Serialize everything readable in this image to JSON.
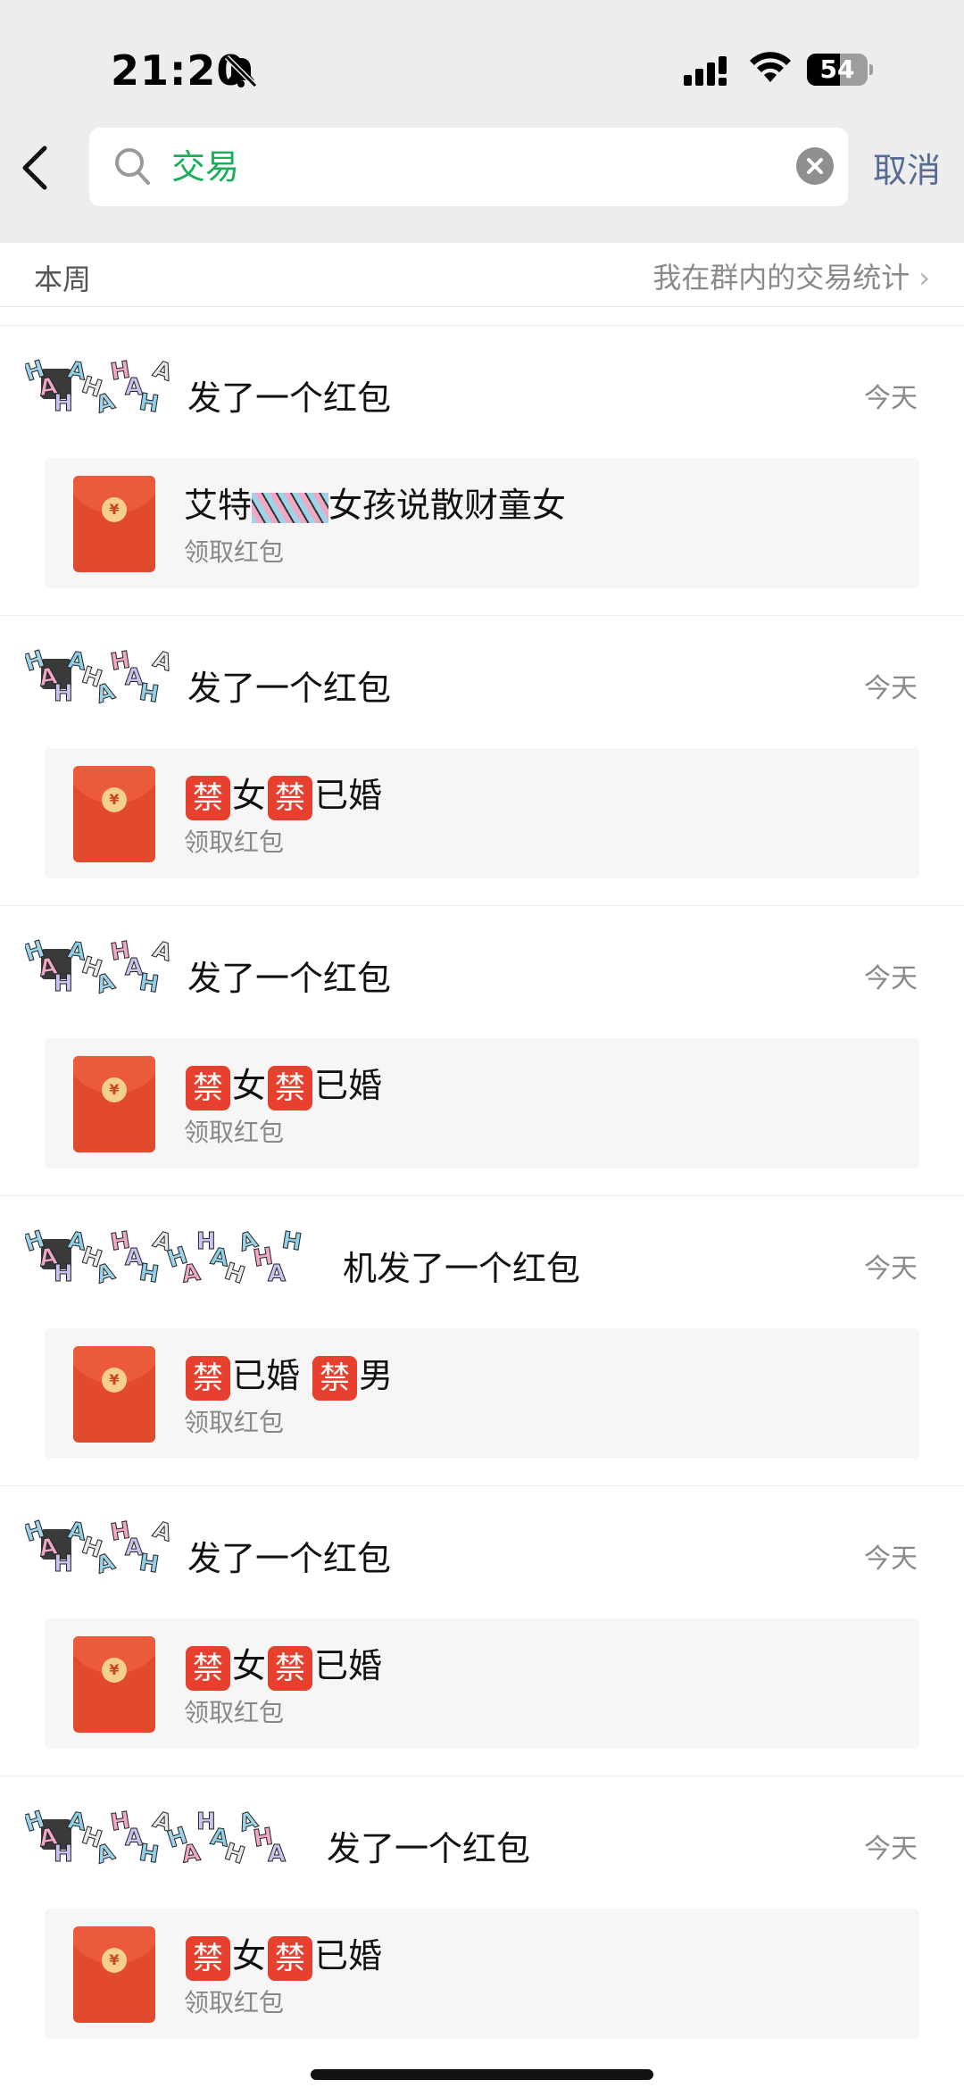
{
  "status_bar": {
    "time": "21:20",
    "battery": "54",
    "battery_level": 0.54
  },
  "search": {
    "query": "交易",
    "cancel_label": "取消"
  },
  "section": {
    "label": "本周",
    "stats_link": "我在群内的交易统计",
    "chevron": "›"
  },
  "records": [
    {
      "sender_suffix": "发了一个红包",
      "time": "今天",
      "packet": {
        "title": "艾特",
        "title_tail": "女孩说散财童女",
        "status": "领取红包"
      }
    },
    {
      "sender_suffix": "发了一个红包",
      "time": "今天",
      "packet": {
        "title_parts": [
          "禁",
          "女",
          "禁",
          "已婚"
        ],
        "status": "领取红包"
      }
    },
    {
      "sender_suffix": "发了一个红包",
      "time": "今天",
      "packet": {
        "title_parts": [
          "禁",
          "女",
          "禁",
          "已婚"
        ],
        "status": "领取红包"
      }
    },
    {
      "sender_suffix": "机发了一个红包",
      "time": "今天",
      "packet": {
        "title_parts": [
          "禁",
          "已婚 ",
          "禁",
          "男"
        ],
        "status": "领取红包"
      }
    },
    {
      "sender_suffix": "发了一个红包",
      "time": "今天",
      "packet": {
        "title_parts": [
          "禁",
          "女",
          "禁",
          "已婚"
        ],
        "status": "领取红包"
      }
    },
    {
      "sender_suffix": "发了一个红包",
      "time": "今天",
      "packet": {
        "title_parts": [
          "禁",
          "女",
          "禁",
          "已婚"
        ],
        "status": "领取红包"
      }
    }
  ],
  "icons": {
    "back": "chevron-left-icon",
    "search": "search-icon",
    "clear": "clear-icon",
    "bell": "bell-slash-icon",
    "signal": "signal-icon",
    "wifi": "wifi-icon",
    "red_packet": "red-packet-icon"
  },
  "colors": {
    "accent_green": "#1aad5a",
    "link_blue": "#576b95",
    "packet_red": "#e24a2d",
    "forbid_red": "#e8402e"
  }
}
